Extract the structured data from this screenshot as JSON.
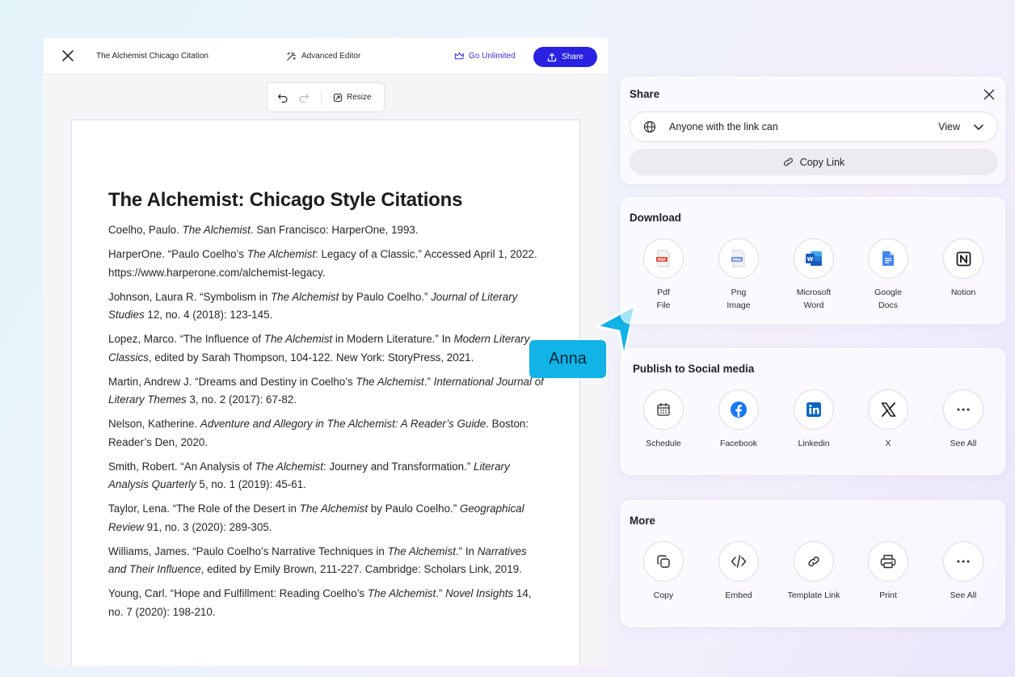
{
  "topbar": {
    "doc_title": "The Alchemist Chicago Citation",
    "advanced_editor": "Advanced Editor",
    "go_unlimited": "Go Unlimited",
    "share": "Share"
  },
  "toolbar": {
    "resize": "Resize"
  },
  "document": {
    "heading": "The Alchemist: Chicago Style Citations"
  },
  "citations": [
    [
      {
        "t": "Coelho, Paulo. "
      },
      {
        "t": "The Alchemist",
        "i": true
      },
      {
        "t": ". San Francisco: HarperOne, 1993."
      }
    ],
    [
      {
        "t": "HarperOne. “Paulo Coelho’s "
      },
      {
        "t": "The Alchemist",
        "i": true
      },
      {
        "t": ": Legacy of a Classic.” Accessed April 1, 2022. https://www.harperone.com/alchemist-legacy."
      }
    ],
    [
      {
        "t": "Johnson, Laura R. “Symbolism in "
      },
      {
        "t": "The Alchemist",
        "i": true
      },
      {
        "t": " by Paulo Coelho.” "
      },
      {
        "t": "Journal of Literary Studies",
        "i": true
      },
      {
        "t": " 12, no. 4 (2018): 123-145."
      }
    ],
    [
      {
        "t": "Lopez, Marco. “The Influence of "
      },
      {
        "t": "The Alchemist",
        "i": true
      },
      {
        "t": " in Modern Literature.” In "
      },
      {
        "t": "Modern Literary Classics",
        "i": true
      },
      {
        "t": ", edited by Sarah Thompson, 104-122. New York: StoryPress, 2021."
      }
    ],
    [
      {
        "t": "Martin, Andrew J. “Dreams and Destiny in Coelho’s "
      },
      {
        "t": "The Alchemist",
        "i": true
      },
      {
        "t": ".” "
      },
      {
        "t": "International Journal of Literary Themes",
        "i": true
      },
      {
        "t": " 3, no. 2 (2017): 67-82."
      }
    ],
    [
      {
        "t": "Nelson, Katherine. "
      },
      {
        "t": "Adventure and Allegory in The Alchemist: A Reader’s Guide",
        "i": true
      },
      {
        "t": ". Boston: Reader’s Den, 2020."
      }
    ],
    [
      {
        "t": "Smith, Robert. “An Analysis of "
      },
      {
        "t": "The Alchemist",
        "i": true
      },
      {
        "t": ": Journey and Transformation.” "
      },
      {
        "t": "Literary Analysis Quarterly",
        "i": true
      },
      {
        "t": " 5, no. 1 (2019): 45-61."
      }
    ],
    [
      {
        "t": "Taylor, Lena. “The Role of the Desert in "
      },
      {
        "t": "The Alchemist",
        "i": true
      },
      {
        "t": " by Paulo Coelho.” "
      },
      {
        "t": "Geographical Review",
        "i": true
      },
      {
        "t": " 91, no. 3 (2020): 289-305."
      }
    ],
    [
      {
        "t": "Williams, James. “Paulo Coelho’s Narrative Techniques in "
      },
      {
        "t": "The Alchemist",
        "i": true
      },
      {
        "t": ".” In "
      },
      {
        "t": "Narratives and Their Influence",
        "i": true
      },
      {
        "t": ", edited by Emily Brown, 211-227. Cambridge: Scholars Link, 2019."
      }
    ],
    [
      {
        "t": "Young, Carl. “Hope and Fulfillment: Reading Coelho’s "
      },
      {
        "t": "The Alchemist",
        "i": true
      },
      {
        "t": ".” "
      },
      {
        "t": "Novel Insights",
        "i": true
      },
      {
        "t": " 14, no. 7 (2020): 198-210."
      }
    ]
  ],
  "cursor": {
    "name": "Anna",
    "color": "#12b3e6"
  },
  "share_panel": {
    "title": "Share",
    "access_text": "Anyone with the link can",
    "access_value": "View",
    "copy_link": "Copy Link"
  },
  "download": {
    "title": "Download",
    "items": [
      {
        "label": "Pdf\nFile",
        "icon": "pdf-icon"
      },
      {
        "label": "Png\nImage",
        "icon": "png-icon"
      },
      {
        "label": "Microsoft\nWord",
        "icon": "word-icon"
      },
      {
        "label": "Google\nDocs",
        "icon": "google-docs-icon"
      },
      {
        "label": "Notion",
        "icon": "notion-icon"
      }
    ]
  },
  "social": {
    "title": "Publish to Social media",
    "items": [
      {
        "label": "Schedule",
        "icon": "calendar-icon"
      },
      {
        "label": "Facebook",
        "icon": "facebook-icon"
      },
      {
        "label": "Linkedin",
        "icon": "linkedin-icon"
      },
      {
        "label": "X",
        "icon": "x-icon"
      },
      {
        "label": "See All",
        "icon": "more-icon"
      }
    ]
  },
  "more": {
    "title": "More",
    "items": [
      {
        "label": "Copy",
        "icon": "copy-icon"
      },
      {
        "label": "Embed",
        "icon": "code-icon"
      },
      {
        "label": "Template Link",
        "icon": "link-icon"
      },
      {
        "label": "Print",
        "icon": "printer-icon"
      },
      {
        "label": "See All",
        "icon": "more-icon"
      }
    ]
  },
  "colors": {
    "accent": "#2a22e0",
    "unlimited": "#3b30d6",
    "facebook": "#1877f2",
    "linkedin": "#0a66c2",
    "word": "#185abd",
    "pdf": "#e5483f",
    "docs": "#4285f4"
  }
}
